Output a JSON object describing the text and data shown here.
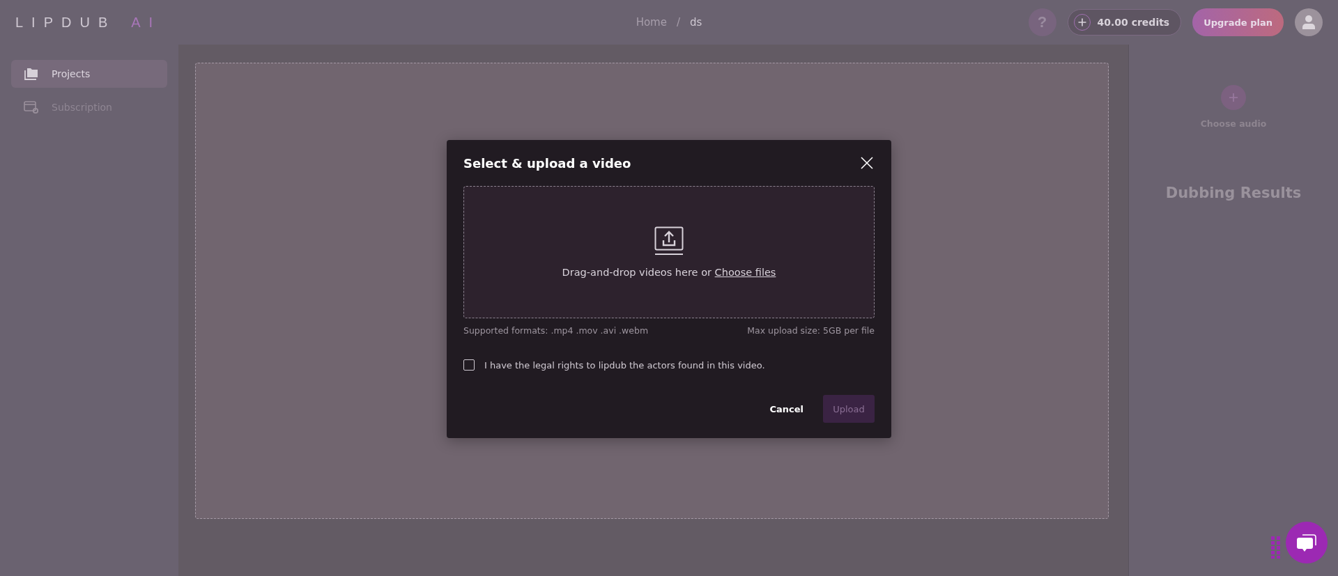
{
  "logo": {
    "word": "LIPDUB",
    "suffix": "AI"
  },
  "breadcrumb": [
    {
      "label": "Home",
      "current": false
    },
    {
      "label": "ds",
      "current": true
    }
  ],
  "breadcrumb_separator": "/",
  "header": {
    "help": "?",
    "credits": "40.00 credits",
    "upgrade": "Upgrade plan"
  },
  "sidebar": {
    "items": [
      {
        "label": "Projects",
        "kind": "folder",
        "selected": true
      },
      {
        "label": "Subscription",
        "kind": "billing",
        "selected": false
      }
    ]
  },
  "right_panel": {
    "choose_audio": "Choose audio",
    "results_title": "Dubbing Results"
  },
  "modal": {
    "title": "Select & upload a video",
    "drop_text": "Drag-and-drop videos here or",
    "choose_link": "Choose files",
    "formats": "Supported formats: .mp4 .mov .avi .webm",
    "max_size": "Max upload size: 5GB per file",
    "consent": {
      "label": "I have the legal rights to lipdub the actors found in this video.",
      "checked": false
    },
    "cancel": "Cancel",
    "upload": {
      "label": "Upload",
      "disabled": true
    }
  }
}
